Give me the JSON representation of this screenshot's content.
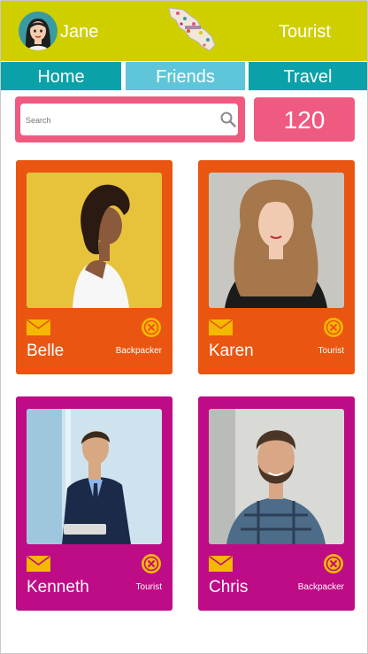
{
  "header": {
    "user_name": "Jane",
    "user_role": "Tourist",
    "colors": {
      "bg": "#cfcf00"
    }
  },
  "tabs": [
    {
      "label": "Home",
      "active": false
    },
    {
      "label": "Friends",
      "active": true
    },
    {
      "label": "Travel",
      "active": false
    }
  ],
  "search": {
    "placeholder": "Search",
    "icon": "search-icon"
  },
  "counter": {
    "value": "120"
  },
  "cards": [
    {
      "name": "Belle",
      "type": "Backpacker",
      "color": "#ea5511"
    },
    {
      "name": "Karen",
      "type": "Tourist",
      "color": "#ea5511"
    },
    {
      "name": "Kenneth",
      "type": "Tourist",
      "color": "#be0b86"
    },
    {
      "name": "Chris",
      "type": "Backpacker",
      "color": "#be0b86"
    }
  ],
  "icons": {
    "message": "mail-icon",
    "remove": "close-circle-icon"
  }
}
